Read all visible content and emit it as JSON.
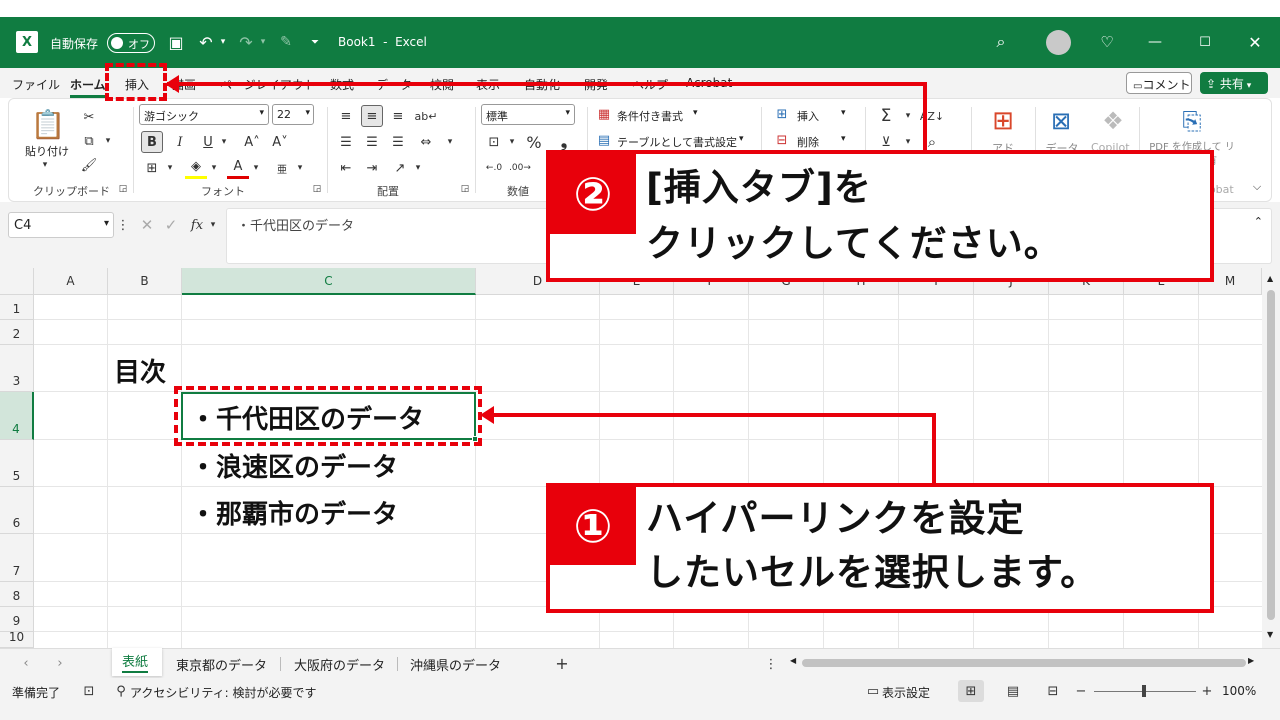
{
  "titlebar": {
    "autosave_label": "自動保存",
    "autosave_toggle": "オフ",
    "doc_title": "Book1  -  Excel"
  },
  "tabs": [
    "ファイル",
    "ホーム",
    "挿入",
    "描画",
    "ページレイアウト",
    "数式",
    "データ",
    "校閲",
    "表示",
    "自動化",
    "開発",
    "ヘルプ",
    "Acrobat"
  ],
  "top_right": {
    "comments": "コメント",
    "share": "共有"
  },
  "ribbon": {
    "paste": "貼り付け",
    "clipboard": "クリップボード",
    "font_name": "游ゴシック",
    "font_size": "22",
    "font_group": "フォント",
    "align_group": "配置",
    "number_format": "標準",
    "number_group": "数値",
    "cond_format": "条件付き書式",
    "table_format": "テーブルとして書式設定",
    "insert": "挿入",
    "delete": "削除",
    "addin": "アドイン",
    "data_analysis": "データ分析",
    "copilot": "Copilot",
    "pdf": "PDF を作成して リンクを共有",
    "adobe": "Adobe Acrobat"
  },
  "formula": {
    "namebox": "C4",
    "content": "・千代田区のデータ"
  },
  "columns": [
    "A",
    "B",
    "C",
    "D",
    "E",
    "F",
    "G",
    "H",
    "I",
    "J",
    "K",
    "L",
    "M"
  ],
  "rows": [
    "1",
    "2",
    "3",
    "4",
    "5",
    "6",
    "7",
    "8",
    "9",
    "10"
  ],
  "cells": {
    "b3": "目次",
    "c4": "・千代田区のデータ",
    "c5": "・浪速区のデータ",
    "c6": "・那覇市のデータ"
  },
  "sheets": [
    "表紙",
    "東京都のデータ",
    "大阪府のデータ",
    "沖縄県のデータ"
  ],
  "status": {
    "ready": "準備完了",
    "accessibility": "アクセシビリティ: 検討が必要です",
    "display_settings": "表示設定",
    "zoom": "100%"
  },
  "callout1": {
    "number": "①",
    "line1": "ハイパーリンクを設定",
    "line2": "したいセルを選択します。"
  },
  "callout2": {
    "number": "②",
    "line1": "[挿入タブ]を",
    "line2": "クリックしてください。"
  },
  "colors": {
    "excel_green": "#107c41",
    "annotation_red": "#e8000b"
  }
}
